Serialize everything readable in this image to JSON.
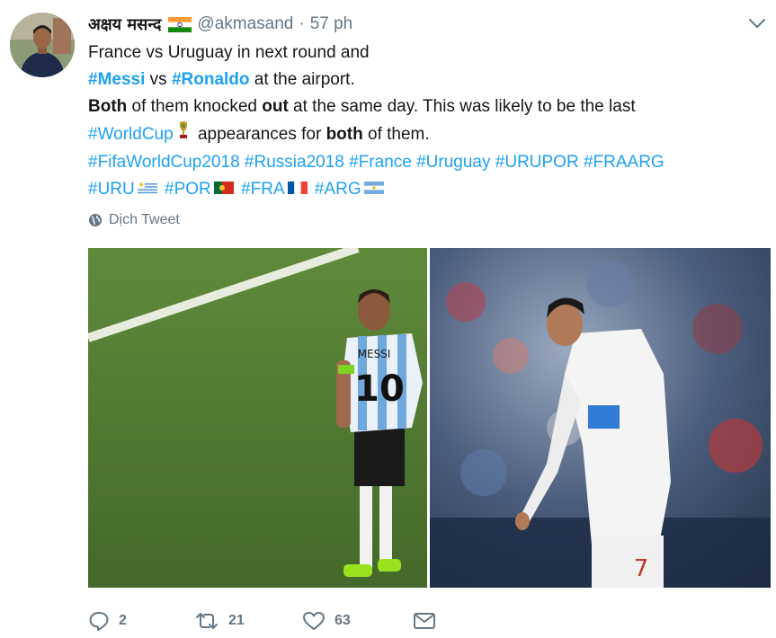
{
  "tweet": {
    "author_name": "अक्षय मसन्द",
    "author_flag": "india-flag",
    "handle": "@akmasand",
    "separator": "·",
    "time": "57 ph",
    "lines": {
      "l1": "France vs Uruguay in next round and",
      "l2_tag1": "#Messi",
      "l2_vs": " vs ",
      "l2_tag2": "#Ronaldo",
      "l2_rest": " at the airport.",
      "l3_b1": "Both",
      "l3_t1": " of them knocked ",
      "l3_b2": "out",
      "l3_t2": " at the same day. This was likely to be the last",
      "l4_tag": "#WorldCup",
      "l4_t1": " appearances for ",
      "l4_b": "both",
      "l4_t2": " of them.",
      "l5_tags": [
        "#FifaWorldCup2018",
        "#Russia2018",
        "#France",
        "#Uruguay",
        "#URUPOR",
        "#FRAARG"
      ],
      "l6_tags": [
        "#URU",
        "#POR",
        "#FRA",
        "#ARG"
      ]
    },
    "translate_label": "Dịch Tweet",
    "photos": [
      {
        "name": "messi-photo",
        "jersey_name": "MESSI",
        "jersey_number": "10"
      },
      {
        "name": "ronaldo-photo",
        "jersey_number": "7"
      }
    ],
    "actions": {
      "replies": "2",
      "retweets": "21",
      "likes": "63"
    }
  },
  "colors": {
    "link": "#1da1f2",
    "secondary": "#657786",
    "text": "#14171a"
  },
  "icons": [
    "chevron-down-icon",
    "globe-icon",
    "reply-icon",
    "retweet-icon",
    "like-icon",
    "message-icon",
    "world-cup-trophy-icon"
  ]
}
